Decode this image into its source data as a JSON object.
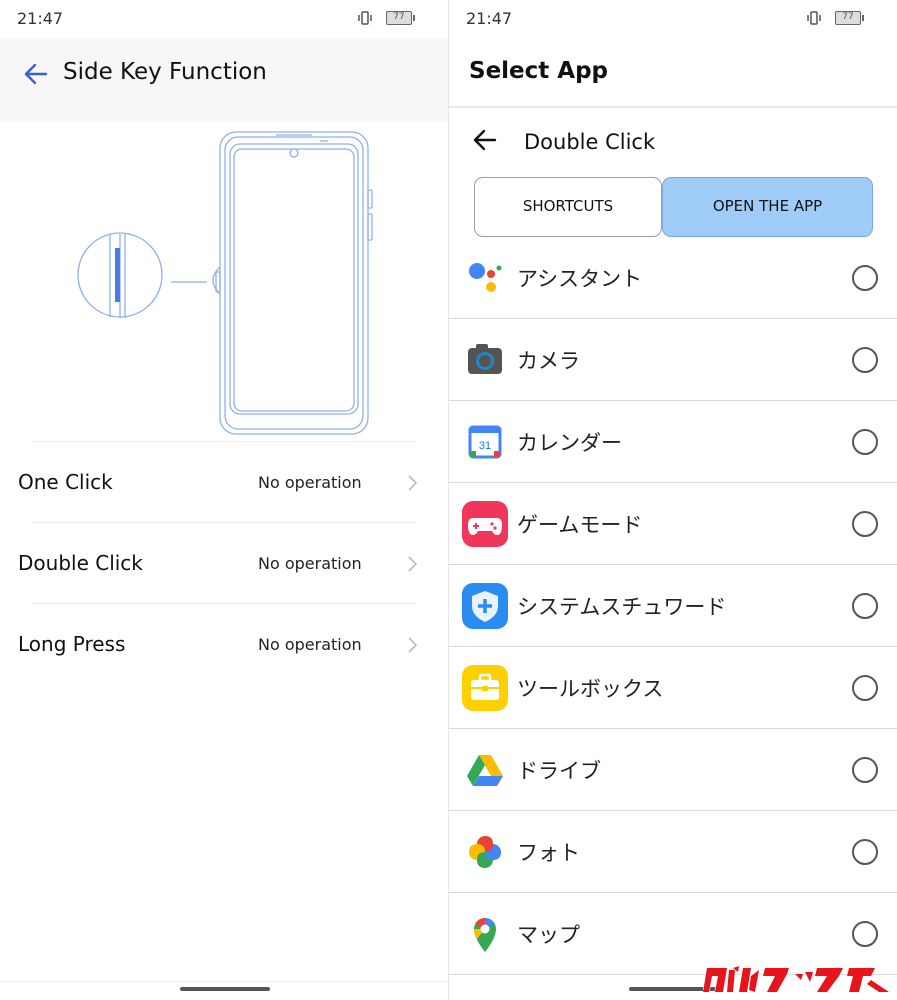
{
  "left_screen": {
    "status": {
      "time": "21:47",
      "battery": "77"
    },
    "header": {
      "title": "Side Key Function"
    },
    "rows": [
      {
        "label": "One Click",
        "value": "No operation"
      },
      {
        "label": "Double Click",
        "value": "No operation"
      },
      {
        "label": "Long Press",
        "value": "No operation"
      }
    ]
  },
  "right_screen": {
    "status": {
      "time": "21:47",
      "battery": "77"
    },
    "title": "Select App",
    "subheader": {
      "label": "Double Click"
    },
    "tabs": {
      "shortcuts": "SHORTCUTS",
      "open_app": "OPEN THE APP"
    },
    "apps": [
      {
        "name": "アシスタント",
        "icon": "google-assistant-icon"
      },
      {
        "name": "カメラ",
        "icon": "camera-icon"
      },
      {
        "name": "カレンダー",
        "icon": "calendar-icon",
        "badge": "31"
      },
      {
        "name": "ゲームモード",
        "icon": "gamepad-icon"
      },
      {
        "name": "システムスチュワード",
        "icon": "shield-icon"
      },
      {
        "name": "ツールボックス",
        "icon": "toolbox-icon"
      },
      {
        "name": "ドライブ",
        "icon": "drive-icon"
      },
      {
        "name": "フォト",
        "icon": "photos-pinwheel-icon"
      },
      {
        "name": "マップ",
        "icon": "maps-pin-icon"
      }
    ]
  },
  "colors": {
    "accent_blue": "#3b5bdb",
    "tab_active": "#9fcdf8",
    "watermark_red": "#e8141c"
  }
}
